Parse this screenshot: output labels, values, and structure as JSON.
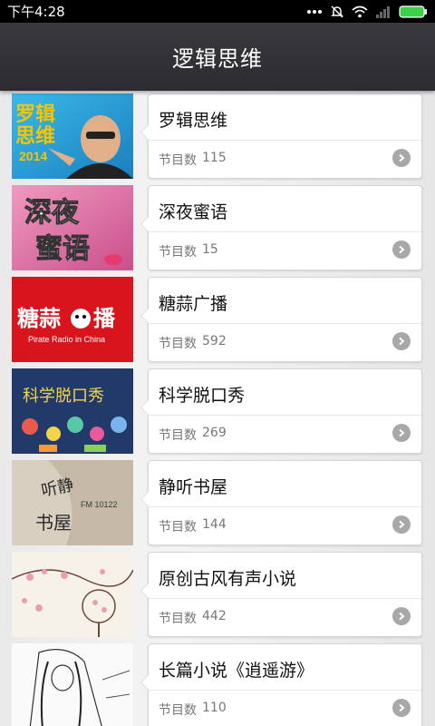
{
  "status": {
    "time": "下午4:28"
  },
  "header": {
    "title": "逻辑思维"
  },
  "count_label": "节目数",
  "items": [
    {
      "title": "罗辑思维",
      "count": "115",
      "thumb_text": "罗辑思维 2014"
    },
    {
      "title": "深夜蜜语",
      "count": "15",
      "thumb_text": "深夜蜜语"
    },
    {
      "title": "糖蒜广播",
      "count": "592",
      "thumb_text": "糖蒜广播",
      "thumb_sub": "Pirate Radio in China"
    },
    {
      "title": "科学脱口秀",
      "count": "269",
      "thumb_text": "科学脱口秀"
    },
    {
      "title": "静听书屋",
      "count": "144",
      "thumb_text": "听静书屋",
      "thumb_sub": "FM 10122"
    },
    {
      "title": "原创古风有声小说",
      "count": "442"
    },
    {
      "title": "长篇小说《逍遥游》",
      "count": "110"
    }
  ],
  "colors": {
    "titlebar": "#323236",
    "chevron": "#a8a8a8",
    "card_border": "#d6d6d6"
  }
}
